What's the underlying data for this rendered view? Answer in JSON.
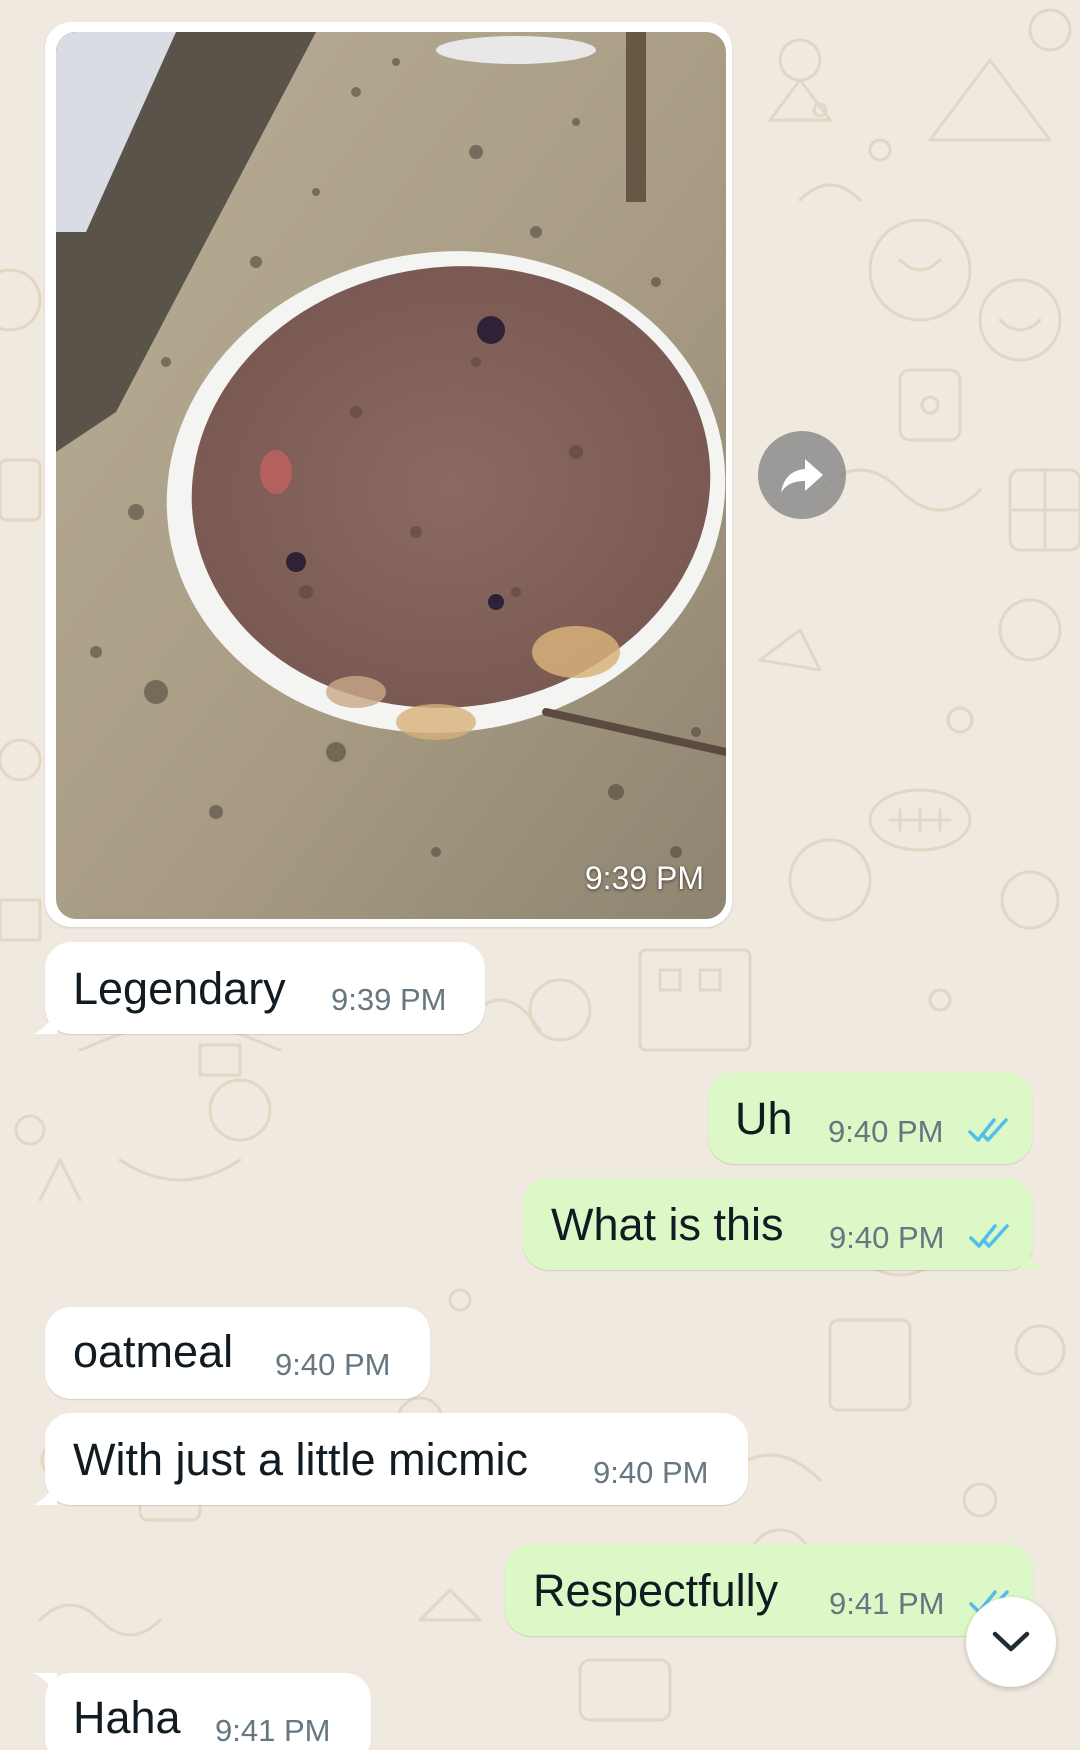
{
  "colors": {
    "wallpaper": "#efe9df",
    "incoming_bubble": "#ffffff",
    "outgoing_bubble": "#dbf8c6",
    "read_ticks": "#53bdeb",
    "timestamp": "#667781"
  },
  "image_message": {
    "time": "9:39 PM",
    "forward_icon": "share-forward-icon"
  },
  "messages": [
    {
      "text": "Legendary",
      "time": "9:39 PM",
      "direction": "incoming"
    },
    {
      "text": "Uh",
      "time": "9:40 PM",
      "direction": "outgoing",
      "status": "read"
    },
    {
      "text": "What is this",
      "time": "9:40 PM",
      "direction": "outgoing",
      "status": "read"
    },
    {
      "text": "oatmeal",
      "time": "9:40 PM",
      "direction": "incoming"
    },
    {
      "text": "With just a little micmic",
      "time": "9:40 PM",
      "direction": "incoming"
    },
    {
      "text": "Respectfully",
      "time": "9:41 PM",
      "direction": "outgoing",
      "status": "read"
    },
    {
      "text": "Haha",
      "time": "9:41 PM",
      "direction": "incoming"
    }
  ],
  "scroll_button_icon": "chevron-down-icon"
}
